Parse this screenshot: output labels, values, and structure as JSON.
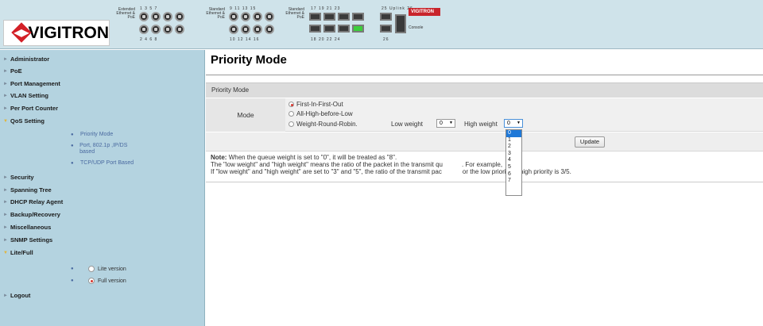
{
  "header": {
    "brand": "VIGITRON",
    "brand_small": "VIGITRON",
    "panel1": {
      "label": "Extended Ethernet & PoE",
      "top_nums": "1 3 5 7",
      "bottom_nums": "2 4 6 8"
    },
    "panel2": {
      "label": "Standard Ethernet & PoE",
      "top_nums": "9 11 13 15",
      "bottom_nums": "10 12 14 16"
    },
    "panel3": {
      "label": "Standard Ethernet & PoE",
      "top_nums": "17 19 21 23",
      "bottom_nums": "18 20 22 24",
      "extra_top": "25 Uplink 26",
      "extra_bottom": "26"
    },
    "console_label": "Console"
  },
  "sidebar": {
    "items": [
      {
        "label": "Administrator"
      },
      {
        "label": "PoE"
      },
      {
        "label": "Port Management"
      },
      {
        "label": "VLAN Setting"
      },
      {
        "label": "Per Port Counter"
      },
      {
        "label": "QoS Setting"
      },
      {
        "label": "Security"
      },
      {
        "label": "Spanning Tree"
      },
      {
        "label": "DHCP Relay Agent"
      },
      {
        "label": "Backup/Recovery"
      },
      {
        "label": "Miscellaneous"
      },
      {
        "label": "SNMP Settings"
      },
      {
        "label": "Lite/Full"
      },
      {
        "label": "Logout"
      }
    ],
    "qos_sub": [
      {
        "label": "Priority Mode"
      },
      {
        "label": "Port, 802.1p ,IP/DS based"
      },
      {
        "label": "TCP/UDP Port Based"
      }
    ],
    "lite_full": [
      {
        "label": "Lite version"
      },
      {
        "label": "Full version"
      }
    ]
  },
  "main": {
    "title": "Priority Mode",
    "section": "Priority Mode",
    "mode_label": "Mode",
    "options": [
      "First-In-First-Out",
      "All-High-before-Low",
      "Weight-Round-Robin."
    ],
    "low_weight_label": "Low weight",
    "low_weight_value": "0",
    "high_weight_label": "High weight",
    "high_weight_value": "0",
    "update_button": "Update",
    "note_label": "Note:",
    "note_line1": "When the queue weight is set to \"0\", it will be treated as \"8\".",
    "note_line2": "The \"low weight\" and \"high weight\" means the ratio of the packet in the transmit qu",
    "note_line2_end": ". For example,",
    "note_line3": "If \"low weight\" and \"high weight\" are set to \"3\" and \"5\", the ratio of the transmit pac",
    "note_line3_end": "or the low priority to high priority is 3/5.",
    "dropdown_options": [
      "0",
      "1",
      "2",
      "3",
      "4",
      "5",
      "6",
      "7"
    ]
  }
}
